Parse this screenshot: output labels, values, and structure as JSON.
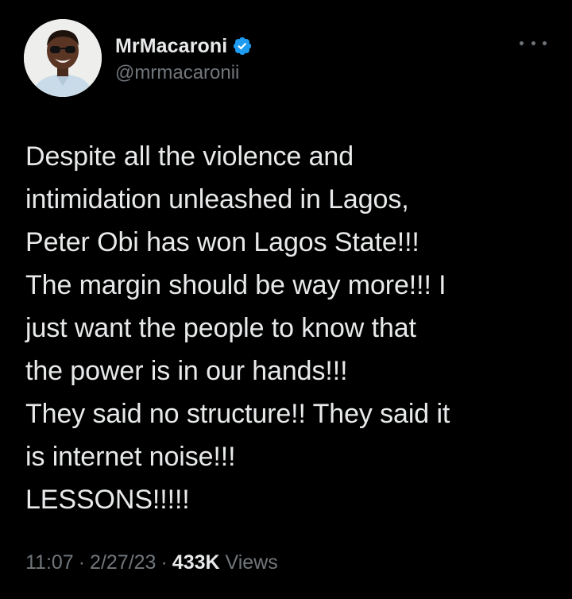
{
  "tweet": {
    "author": {
      "display_name": "MrMacaroni",
      "handle": "@mrmacaronii",
      "verified": true,
      "avatar_icon": "profile-photo"
    },
    "more_icon": "more-options-icon",
    "text_lines": [
      "Despite all the violence and",
      "intimidation unleashed in Lagos,",
      "Peter Obi has won Lagos State!!!",
      "The margin should be way more!!! I",
      "just want the people to know that",
      "the power is in our hands!!!",
      "They said no structure!! They said it",
      "is internet noise!!!",
      "LESSONS!!!!!"
    ],
    "meta": {
      "time": "11:07",
      "separator": "·",
      "date": "2/27/23",
      "views_count": "433K",
      "views_label": "Views"
    }
  },
  "colors": {
    "background": "#000000",
    "primary_text": "#e7e9ea",
    "secondary_text": "#71767b",
    "verified_badge": "#1d9bf0"
  }
}
